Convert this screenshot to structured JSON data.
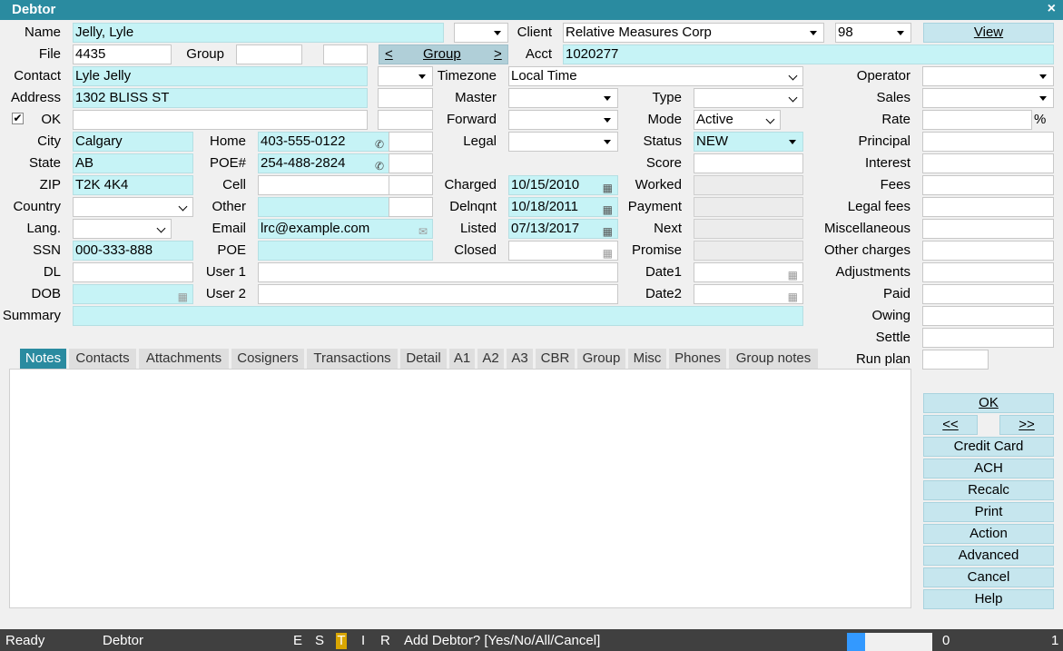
{
  "window": {
    "title": "Debtor",
    "close": "×"
  },
  "labels": {
    "name": "Name",
    "file": "File",
    "group": "Group",
    "contact": "Contact",
    "address": "Address",
    "ok": "OK",
    "city": "City",
    "state": "State",
    "zip": "ZIP",
    "country": "Country",
    "lang": "Lang.",
    "ssn": "SSN",
    "dl": "DL",
    "dob": "DOB",
    "summary": "Summary",
    "client": "Client",
    "acct": "Acct",
    "timezone": "Timezone",
    "master": "Master",
    "forward": "Forward",
    "legal": "Legal",
    "home": "Home",
    "poe_num": "POE#",
    "cell": "Cell",
    "other": "Other",
    "email": "Email",
    "poe": "POE",
    "user1": "User 1",
    "user2": "User 2",
    "charged": "Charged",
    "delnqnt": "Delnqnt",
    "listed": "Listed",
    "closed": "Closed",
    "type": "Type",
    "mode": "Mode",
    "status": "Status",
    "score": "Score",
    "worked": "Worked",
    "payment": "Payment",
    "next": "Next",
    "promise": "Promise",
    "date1": "Date1",
    "date2": "Date2",
    "operator": "Operator",
    "sales": "Sales",
    "rate": "Rate",
    "rate_unit": "%",
    "principal": "Principal",
    "interest": "Interest",
    "fees": "Fees",
    "legal_fees": "Legal fees",
    "miscellaneous": "Miscellaneous",
    "other_charges": "Other charges",
    "adjustments": "Adjustments",
    "paid": "Paid",
    "owing": "Owing",
    "settle": "Settle",
    "run_plan": "Run plan"
  },
  "values": {
    "name": "Jelly, Lyle",
    "file": "4435",
    "contact": "Lyle Jelly",
    "address": "1302 BLISS ST",
    "city": "Calgary",
    "state": "AB",
    "zip": "T2K 4K4",
    "ssn": "000-333-888",
    "client": "Relative Measures Corp",
    "client_code": "98",
    "acct": "1020277",
    "timezone": "Local Time",
    "home": "403-555-0122",
    "poe_num": "254-488-2824",
    "email": "lrc@example.com",
    "charged": "10/15/2010",
    "delnqnt": "10/18/2011",
    "listed": "07/13/2017",
    "mode": "Active",
    "status": "NEW"
  },
  "buttons": {
    "view": "View",
    "group_prev": "<",
    "group": "Group",
    "group_next": ">",
    "ok": "OK",
    "prev": "<<",
    "next": ">>",
    "credit_card": "Credit Card",
    "ach": "ACH",
    "recalc": "Recalc",
    "print": "Print",
    "action": "Action",
    "advanced": "Advanced",
    "cancel": "Cancel",
    "help": "Help"
  },
  "tabs": [
    "Notes",
    "Contacts",
    "Attachments",
    "Cosigners",
    "Transactions",
    "Detail",
    "A1",
    "A2",
    "A3",
    "CBR",
    "Group",
    "Misc",
    "Phones",
    "Group notes"
  ],
  "statusbar": {
    "ready": "Ready",
    "module": "Debtor",
    "e": "E",
    "s": "S",
    "t": "T",
    "i": "I",
    "r": "R",
    "prompt": "Add Debtor? [Yes/No/All/Cancel]",
    "count": "0",
    "page": "1"
  },
  "icons": {
    "phone": "phone-icon",
    "email": "envelope-icon",
    "calendar": "calendar-icon",
    "check": "checkmark-icon",
    "dropdown": "chevron-down-icon"
  },
  "colors": {
    "accent": "#2a8ba0",
    "field_cyan": "#c6f3f6",
    "button": "#c6e6ee",
    "status_bar": "#404040",
    "progress": "#3399ff"
  },
  "ok_checked": true
}
